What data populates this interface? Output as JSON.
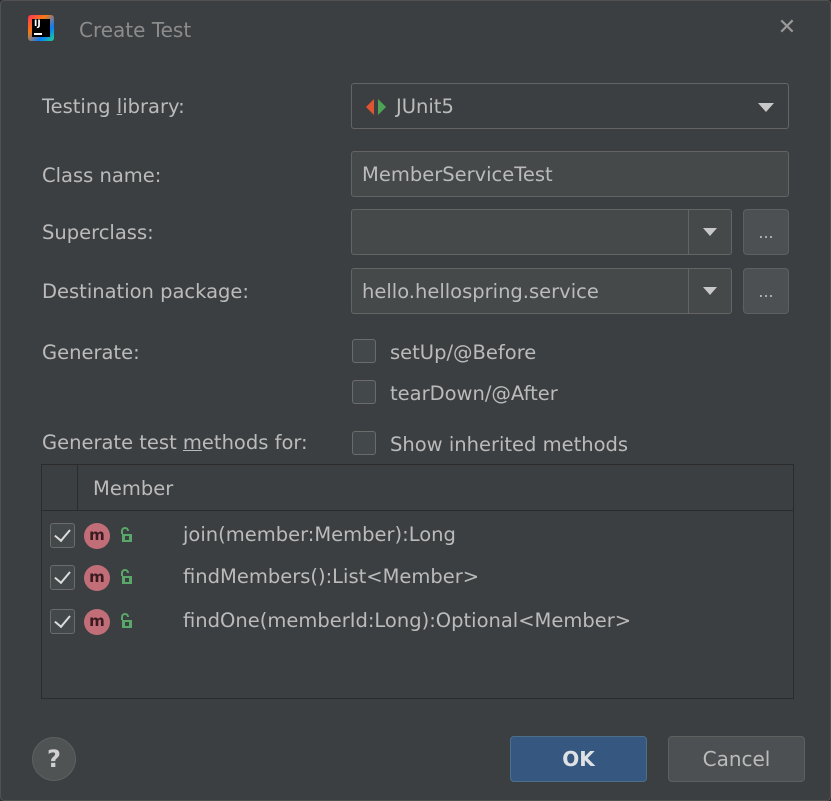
{
  "window": {
    "title": "Create Test",
    "app_icon_text": "IJ"
  },
  "form": {
    "testing_library": {
      "label_pre": "Testing ",
      "label_mn": "l",
      "label_post": "ibrary:",
      "value": "JUnit5"
    },
    "class_name": {
      "label": "Class name:",
      "value": "MemberServiceTest"
    },
    "superclass": {
      "label": "Superclass:",
      "value": "",
      "browse": "..."
    },
    "destination_package": {
      "label": "Destination package:",
      "value": "hello.hellospring.service",
      "browse": "..."
    },
    "generate": {
      "label": "Generate:",
      "options": [
        {
          "label": "setUp/@Before",
          "checked": false
        },
        {
          "label": "tearDown/@After",
          "checked": false
        }
      ]
    },
    "methods_for": {
      "label_pre": "Generate test ",
      "label_mn": "m",
      "label_post": "ethods for:"
    },
    "show_inherited": {
      "label": "Show inherited methods",
      "checked": false
    }
  },
  "members_table": {
    "column": "Member",
    "rows": [
      {
        "icon": "m",
        "signature": "join(member:Member):Long",
        "checked": true
      },
      {
        "icon": "m",
        "signature": "findMembers():List<Member>",
        "checked": true
      },
      {
        "icon": "m",
        "signature": "findOne(memberId:Long):Optional<Member>",
        "checked": true
      }
    ]
  },
  "footer": {
    "help": "?",
    "ok": "OK",
    "cancel": "Cancel"
  },
  "colors": {
    "background": "#3c3f41",
    "ok_button": "#365880",
    "method_icon": "#c26e79",
    "unlock_icon": "#59a869",
    "junit_green": "#4ea356",
    "junit_red": "#e05531"
  }
}
